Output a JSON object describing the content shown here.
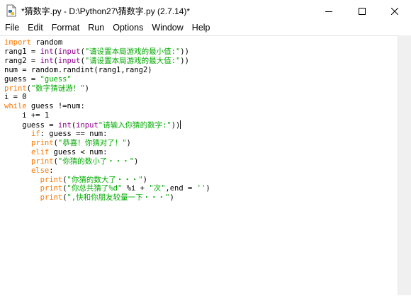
{
  "window": {
    "title": "*猜数字.py - D:\\Python27\\猜数字.py (2.7.14)*",
    "icons": {
      "app": "python-file-icon",
      "minimize": "minimize-icon",
      "maximize": "maximize-icon",
      "close": "close-icon"
    }
  },
  "menu": {
    "items": [
      "File",
      "Edit",
      "Format",
      "Run",
      "Options",
      "Window",
      "Help"
    ]
  },
  "code": {
    "colors": {
      "keyword": "#ff7700",
      "builtin": "#900090",
      "string": "#00aa00",
      "default": "#000000"
    },
    "lines": [
      [
        [
          "kw",
          "import"
        ],
        [
          "n",
          " random"
        ]
      ],
      [
        [
          "n",
          "rang1 = "
        ],
        [
          "bi",
          "int"
        ],
        [
          "n",
          "("
        ],
        [
          "bi",
          "input"
        ],
        [
          "n",
          "("
        ],
        [
          "str",
          "\"请设置本局游戏的最小值:\""
        ],
        [
          "n",
          "))"
        ]
      ],
      [
        [
          "n",
          "rang2 = "
        ],
        [
          "bi",
          "int"
        ],
        [
          "n",
          "("
        ],
        [
          "bi",
          "input"
        ],
        [
          "n",
          "("
        ],
        [
          "str",
          "\"请设置本局游戏的最大值:\""
        ],
        [
          "n",
          "))"
        ]
      ],
      [
        [
          "n",
          "num = random.randint(rang1,rang2)"
        ]
      ],
      [
        [
          "n",
          "guess = "
        ],
        [
          "str",
          "\"guess\""
        ]
      ],
      [
        [
          "kw",
          "print"
        ],
        [
          "n",
          "("
        ],
        [
          "str",
          "\"数字猜谜游！\""
        ],
        [
          "n",
          ")"
        ]
      ],
      [
        [
          "n",
          "i = 0"
        ]
      ],
      [
        [
          "kw",
          "while"
        ],
        [
          "n",
          " guess !=num:"
        ]
      ],
      [
        [
          "n",
          "    i += 1"
        ]
      ],
      [
        [
          "n",
          "    guess = "
        ],
        [
          "bi",
          "int"
        ],
        [
          "n",
          "("
        ],
        [
          "bi",
          "input"
        ],
        [
          "str",
          "\"请输入你猜的数字:\""
        ],
        [
          "n",
          "))"
        ]
      ],
      [
        [
          "n",
          "      "
        ],
        [
          "kw",
          "if"
        ],
        [
          "n",
          ": guess == num:"
        ]
      ],
      [
        [
          "n",
          "      "
        ],
        [
          "kw",
          "print"
        ],
        [
          "n",
          "("
        ],
        [
          "str",
          "\"恭喜！你猜对了！\""
        ],
        [
          "n",
          ")"
        ]
      ],
      [
        [
          "n",
          "      "
        ],
        [
          "kw",
          "elif"
        ],
        [
          "n",
          " guess < num:"
        ]
      ],
      [
        [
          "n",
          "      "
        ],
        [
          "kw",
          "print"
        ],
        [
          "n",
          "("
        ],
        [
          "str",
          "\"你猜的数小了・・・\""
        ],
        [
          "n",
          ")"
        ]
      ],
      [
        [
          "n",
          "      "
        ],
        [
          "kw",
          "else"
        ],
        [
          "n",
          ":"
        ]
      ],
      [
        [
          "n",
          "        "
        ],
        [
          "kw",
          "print"
        ],
        [
          "n",
          "("
        ],
        [
          "str",
          "\"你猜的数大了・・・\""
        ],
        [
          "n",
          ")"
        ]
      ],
      [
        [
          "n",
          "        "
        ],
        [
          "kw",
          "print"
        ],
        [
          "n",
          "("
        ],
        [
          "str",
          "\"你总共猜了%d\""
        ],
        [
          "n",
          " %i + "
        ],
        [
          "str",
          "\"次\""
        ],
        [
          "n",
          ",end = "
        ],
        [
          "str",
          "''"
        ],
        [
          "n",
          ")"
        ]
      ],
      [
        [
          "n",
          "        "
        ],
        [
          "kw",
          "print"
        ],
        [
          "n",
          "("
        ],
        [
          "str",
          "\",快和你朋友较量一下・・・\""
        ],
        [
          "n",
          ")"
        ]
      ]
    ],
    "cursor_line": 9
  }
}
